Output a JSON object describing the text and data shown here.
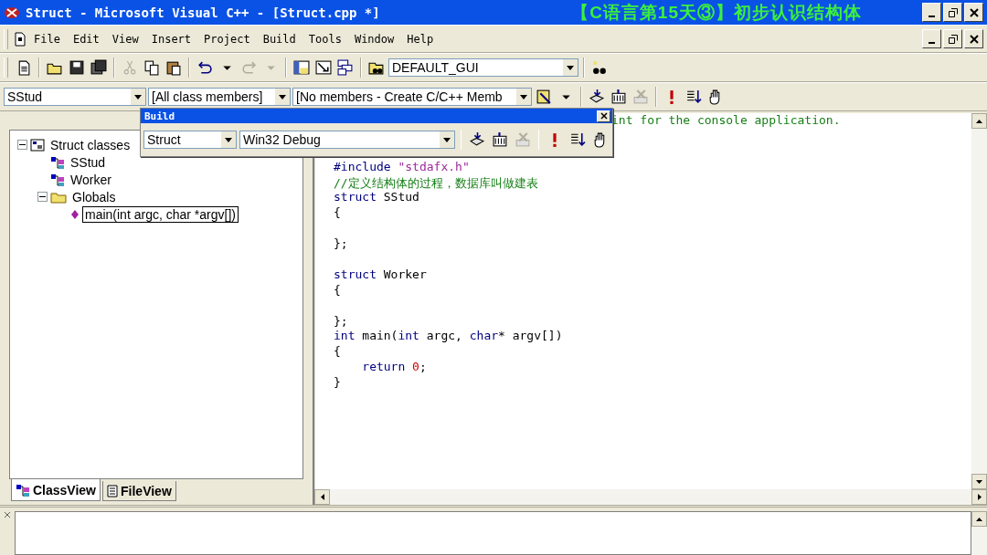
{
  "window": {
    "title": "Struct - Microsoft Visual C++ - [Struct.cpp *]",
    "video_caption": "【C语言第15天③】初步认识结构体"
  },
  "menu": [
    "File",
    "Edit",
    "View",
    "Insert",
    "Project",
    "Build",
    "Tools",
    "Window",
    "Help"
  ],
  "toolbar": [
    {
      "kind": "new",
      "disabled": false
    },
    {
      "kind": "sep"
    },
    {
      "kind": "open",
      "disabled": false
    },
    {
      "kind": "save",
      "disabled": false
    },
    {
      "kind": "saveall",
      "disabled": false
    },
    {
      "kind": "sep"
    },
    {
      "kind": "cut",
      "disabled": true
    },
    {
      "kind": "copy",
      "disabled": false
    },
    {
      "kind": "paste",
      "disabled": false
    },
    {
      "kind": "sep"
    },
    {
      "kind": "undo",
      "disabled": false
    },
    {
      "kind": "drop",
      "disabled": false
    },
    {
      "kind": "redo",
      "disabled": true
    },
    {
      "kind": "drop",
      "disabled": true
    },
    {
      "kind": "sep"
    },
    {
      "kind": "workspace",
      "disabled": false
    },
    {
      "kind": "output",
      "disabled": false
    },
    {
      "kind": "windows",
      "disabled": false
    },
    {
      "kind": "sep"
    },
    {
      "kind": "findfiles",
      "disabled": false
    }
  ],
  "config_combo": {
    "value": "DEFAULT_GUI"
  },
  "toolbar_end": [
    {
      "kind": "find",
      "disabled": false
    }
  ],
  "wizard_bar": {
    "class": "SStud",
    "filter": "[All class members]",
    "members": "[No members - Create C/C++ Memb"
  },
  "wizard_tools": [
    {
      "kind": "wizard",
      "disabled": false
    },
    {
      "kind": "drop",
      "disabled": false
    }
  ],
  "build_mini": [
    {
      "kind": "compile",
      "disabled": false
    },
    {
      "kind": "build",
      "disabled": false
    },
    {
      "kind": "stop",
      "disabled": true
    },
    {
      "kind": "sep"
    },
    {
      "kind": "execute",
      "disabled": false
    },
    {
      "kind": "breakpoint",
      "disabled": false
    },
    {
      "kind": "go",
      "disabled": false
    }
  ],
  "build_toolbar": {
    "title": "Build",
    "project": "Struct",
    "config": "Win32 Debug",
    "tools": [
      {
        "kind": "compile",
        "disabled": false
      },
      {
        "kind": "build",
        "disabled": false
      },
      {
        "kind": "stop",
        "disabled": true
      },
      {
        "kind": "sep"
      },
      {
        "kind": "execute",
        "disabled": false
      },
      {
        "kind": "breakpoint",
        "disabled": false
      },
      {
        "kind": "go",
        "disabled": false
      }
    ]
  },
  "class_tree": [
    {
      "label": "Struct classes",
      "kind": "project",
      "expanded": true,
      "selected": false,
      "children": [
        {
          "label": "SStud",
          "kind": "class",
          "selected": false
        },
        {
          "label": "Worker",
          "kind": "class",
          "selected": false
        },
        {
          "label": "Globals",
          "kind": "folder",
          "expanded": true,
          "selected": false,
          "children": [
            {
              "label": "main(int argc, char *argv[])",
              "kind": "function",
              "selected": true
            }
          ]
        }
      ]
    }
  ],
  "workspace_tabs": [
    {
      "label": "ClassView",
      "kind": "class",
      "selected": true
    },
    {
      "label": "FileView",
      "kind": "file",
      "selected": false
    }
  ],
  "editor": {
    "partial_line": "int for the console application.",
    "lines": [
      {
        "kind": "blank"
      },
      {
        "kind": "blank"
      },
      {
        "kind": "code",
        "tokens": [
          {
            "kind": "keyword",
            "text": "#include "
          },
          {
            "kind": "string",
            "text": "\"stdafx.h\""
          }
        ]
      },
      {
        "kind": "code",
        "tokens": [
          {
            "kind": "comment",
            "text": "//定义结构体的过程，数据库叫做建表"
          }
        ]
      },
      {
        "kind": "code",
        "tokens": [
          {
            "kind": "keyword",
            "text": "struct"
          },
          {
            "kind": "plain",
            "text": " SStud"
          }
        ]
      },
      {
        "kind": "code",
        "tokens": [
          {
            "kind": "plain",
            "text": "{"
          }
        ]
      },
      {
        "kind": "blank"
      },
      {
        "kind": "code",
        "tokens": [
          {
            "kind": "plain",
            "text": "};"
          }
        ]
      },
      {
        "kind": "blank"
      },
      {
        "kind": "code",
        "tokens": [
          {
            "kind": "keyword",
            "text": "struct"
          },
          {
            "kind": "plain",
            "text": " Worker"
          }
        ]
      },
      {
        "kind": "code",
        "tokens": [
          {
            "kind": "plain",
            "text": "{"
          }
        ]
      },
      {
        "kind": "blank"
      },
      {
        "kind": "code",
        "tokens": [
          {
            "kind": "plain",
            "text": "};"
          }
        ]
      },
      {
        "kind": "code",
        "tokens": [
          {
            "kind": "keyword",
            "text": "int"
          },
          {
            "kind": "plain",
            "text": " main("
          },
          {
            "kind": "keyword",
            "text": "int"
          },
          {
            "kind": "plain",
            "text": " argc, "
          },
          {
            "kind": "keyword",
            "text": "char"
          },
          {
            "kind": "plain",
            "text": "* argv[])"
          }
        ]
      },
      {
        "kind": "code",
        "tokens": [
          {
            "kind": "plain",
            "text": "{"
          }
        ]
      },
      {
        "kind": "code",
        "tokens": [
          {
            "kind": "keyword",
            "text": "    return "
          },
          {
            "kind": "number",
            "text": "0"
          },
          {
            "kind": "plain",
            "text": ";"
          }
        ]
      },
      {
        "kind": "code",
        "tokens": [
          {
            "kind": "plain",
            "text": "}"
          }
        ]
      }
    ]
  }
}
